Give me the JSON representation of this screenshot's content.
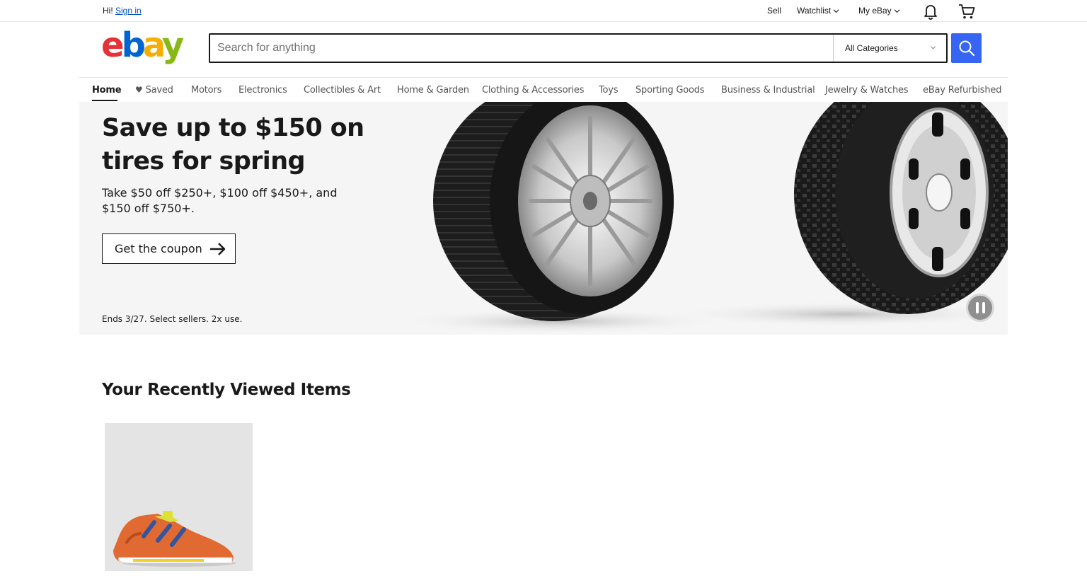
{
  "topbar": {
    "greeting": "Hi!",
    "sign_in": "Sign in",
    "sell": "Sell",
    "watchlist": "Watchlist",
    "my_ebay": "My eBay"
  },
  "header": {
    "logo_text": "ebay",
    "search_placeholder": "Search for anything",
    "category": "All Categories"
  },
  "nav": {
    "items": [
      "Home",
      "Saved",
      "Motors",
      "Electronics",
      "Collectibles & Art",
      "Home & Garden",
      "Clothing & Accessories",
      "Toys",
      "Sporting Goods",
      "Business & Industrial",
      "Jewelry & Watches",
      "eBay Refurbished"
    ]
  },
  "hero": {
    "title": "Save up to $150 on tires for spring",
    "subtitle": "Take $50 off $250+, $100 off $450+, and $150 off $750+.",
    "button": "Get the coupon",
    "fine_print": "Ends 3/27. Select sellers. 2x use."
  },
  "recently_viewed": {
    "title": "Your Recently Viewed Items"
  },
  "colors": {
    "accent": "#3665f3",
    "logo_e": "#e53238",
    "logo_b": "#0064d2",
    "logo_a": "#f5af02",
    "logo_y": "#86b817"
  },
  "icons": {
    "notification": "bell-icon",
    "cart": "cart-icon",
    "search": "search-icon"
  }
}
